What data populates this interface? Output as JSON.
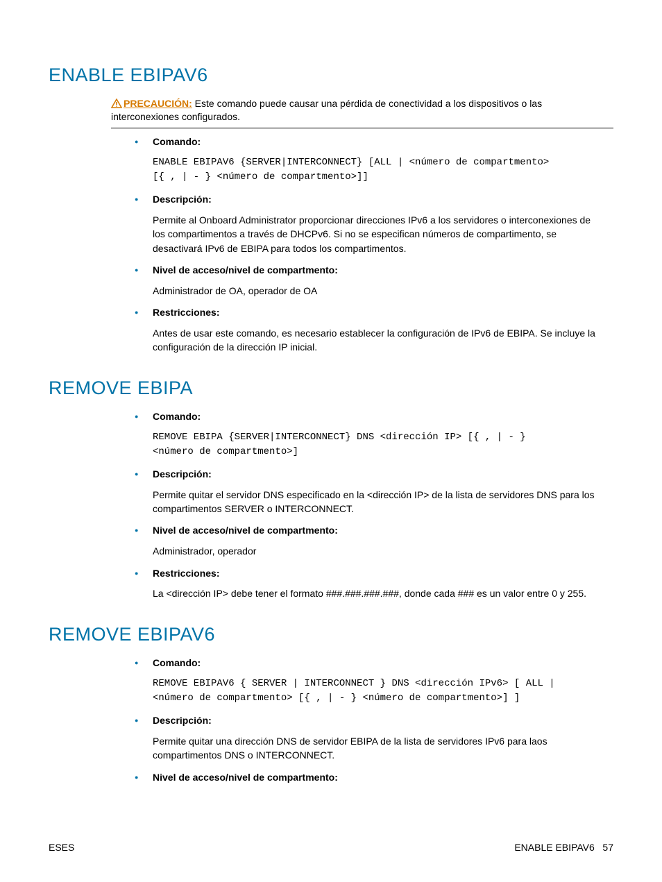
{
  "sections": [
    {
      "title": "ENABLE EBIPAV6",
      "caution": {
        "label": "PRECAUCIÓN:",
        "text": "   Este comando puede causar una pérdida de conectividad a los dispositivos o las interconexiones configurados."
      },
      "items": [
        {
          "label": "Comando:",
          "code": "ENABLE EBIPAV6 {SERVER|INTERCONNECT} [ALL | <número de compartmento>\n[{ , | - } <número de compartmento>]]"
        },
        {
          "label": "Descripción:",
          "body": "Permite al Onboard Administrator proporcionar direcciones IPv6 a los servidores o interconexiones de los compartimentos a través de DHCPv6. Si no se especifican números de compartimento, se desactivará IPv6 de EBIPA para todos los compartimentos."
        },
        {
          "label": "Nivel de acceso/nivel de compartmento:",
          "body": "Administrador de OA, operador de OA"
        },
        {
          "label": "Restricciones:",
          "body": "Antes de usar este comando, es necesario establecer la configuración de IPv6 de EBIPA. Se incluye la configuración de la dirección IP inicial."
        }
      ]
    },
    {
      "title": "REMOVE EBIPA",
      "items": [
        {
          "label": "Comando:",
          "code": "REMOVE EBIPA {SERVER|INTERCONNECT} DNS <dirección IP> [{ , | - }\n<número de compartmento>]"
        },
        {
          "label": "Descripción:",
          "body": "Permite quitar el servidor DNS especificado en la <dirección IP> de la lista de servidores DNS para los compartimentos SERVER o INTERCONNECT."
        },
        {
          "label": "Nivel de acceso/nivel de compartmento:",
          "body": "Administrador, operador"
        },
        {
          "label": "Restricciones:",
          "body": "La <dirección IP> debe tener el formato ###.###.###.###, donde cada ### es un valor entre 0 y 255."
        }
      ]
    },
    {
      "title": "REMOVE EBIPAV6",
      "items": [
        {
          "label": "Comando:",
          "code": "REMOVE EBIPAV6 { SERVER | INTERCONNECT } DNS <dirección IPv6> [ ALL |\n<número de compartmento> [{ , | - } <número de compartmento>] ]"
        },
        {
          "label": "Descripción:",
          "body": "Permite quitar una dirección DNS de servidor EBIPA de la lista de servidores IPv6 para laos compartimentos DNS o INTERCONNECT."
        },
        {
          "label": "Nivel de acceso/nivel de compartmento:"
        }
      ]
    }
  ],
  "footer": {
    "left": "ESES",
    "right": "ENABLE EBIPAV6   57"
  }
}
